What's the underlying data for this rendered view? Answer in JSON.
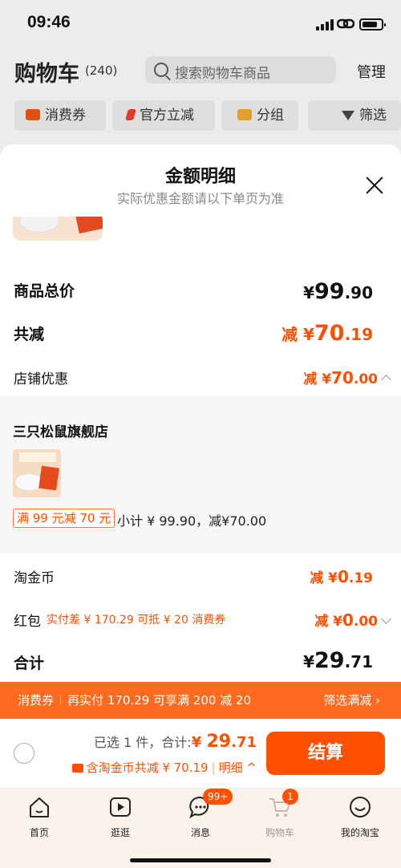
{
  "status_bar": {
    "time": "09:46"
  },
  "header": {
    "title": "购物车",
    "count": "(240)",
    "search_placeholder": "搜索购物车商品",
    "manage": "管理"
  },
  "filters": [
    {
      "label": "消费券",
      "icon": "coupon-icon"
    },
    {
      "label": "官方立减",
      "icon": "lightning-icon"
    },
    {
      "label": "分组",
      "icon": "folder-icon"
    },
    {
      "label": "筛选",
      "icon": "filter-icon"
    }
  ],
  "sheet": {
    "title": "金额明细",
    "subtitle": "实际优惠金额请以下单页为准",
    "total_label": "商品总价",
    "total_symbol": "¥",
    "total_int": "99",
    "total_dec": ".90",
    "reduce_label": "共减",
    "reduce_prefix": "减 ¥",
    "reduce_int": "70",
    "reduce_dec": ".19",
    "shop_discount_label": "店铺优惠",
    "shop_discount_prefix": "减 ¥",
    "shop_discount_int": "70",
    "shop_discount_dec": ".00",
    "store_name": "三只松鼠旗舰店",
    "promo_tag": "满 99 元减 70 元",
    "subtotal": "小计 ¥ 99.90，减¥70.00",
    "coin_label": "淘金币",
    "coin_prefix": "减 ¥",
    "coin_int": "0",
    "coin_dec": ".19",
    "redpacket_label": "红包",
    "redpacket_note": "实付差 ¥ 170.29 可抵 ¥ 20 消费券",
    "redpacket_prefix": "减 ¥",
    "redpacket_int": "0",
    "redpacket_dec": ".00",
    "sum_label": "合计",
    "sum_symbol": "¥",
    "sum_int": "29",
    "sum_dec": ".71"
  },
  "banner": {
    "tag": "消费券",
    "text": "再实付 170.29 可享满 200 减 20",
    "action": "筛选满减 ›"
  },
  "checkout": {
    "selected": "已选 1 件，合计:",
    "amount_symbol": "¥ ",
    "amount_int": "29",
    "amount_dec": ".71",
    "discount": "含淘金币共减 ¥ 70.19",
    "detail": "明细 ^",
    "pay_button": "结算"
  },
  "tabs": [
    {
      "label": "首页",
      "icon": "home-icon"
    },
    {
      "label": "逛逛",
      "icon": "play-icon"
    },
    {
      "label": "消息",
      "icon": "message-icon",
      "badge": "99+"
    },
    {
      "label": "购物车",
      "icon": "cart-icon",
      "badge": "1"
    },
    {
      "label": "我的淘宝",
      "icon": "smile-icon"
    }
  ],
  "colors": {
    "accent": "#ff5000",
    "banner": "#ff6a1e"
  }
}
